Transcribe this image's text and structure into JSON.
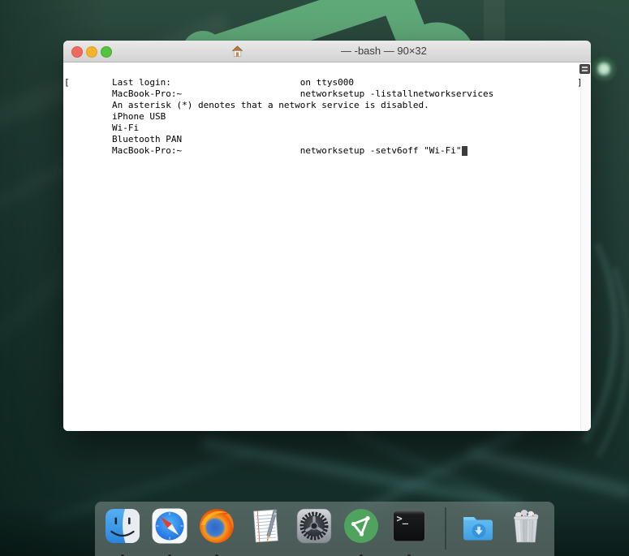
{
  "window": {
    "title": "— -bash — 90×32",
    "traffic_lights": {
      "close_color": "#ee6a5f",
      "minimize_color": "#f4b32e",
      "zoom_color": "#57c23e"
    },
    "proxy_icon": "home-folder-icon",
    "terminal": {
      "left_bracket": "[",
      "right_bracket": "]",
      "lines": [
        "Last login:                        on ttys000",
        "MacBook-Pro:~                      networksetup -listallnetworkservices",
        "An asterisk (*) denotes that a network service is disabled.",
        "iPhone USB",
        "Wi-Fi",
        "Bluetooth PAN",
        "MacBook-Pro:~                      networksetup -setv6off \"Wi-Fi\""
      ],
      "network_services": [
        "iPhone USB",
        "Wi-Fi",
        "Bluetooth PAN"
      ],
      "cursor": "block"
    }
  },
  "dock": {
    "apps": [
      {
        "name": "Finder",
        "running": true
      },
      {
        "name": "Safari",
        "running": true
      },
      {
        "name": "Firefox",
        "running": true
      },
      {
        "name": "TextEdit",
        "running": false
      },
      {
        "name": "System Preferences",
        "running": false
      },
      {
        "name": "VPN",
        "running": true
      },
      {
        "name": "Terminal",
        "running": true
      }
    ],
    "shortcuts": [
      {
        "name": "Downloads"
      },
      {
        "name": "Trash"
      }
    ]
  },
  "wallpaper": {
    "base_color": "#22423a",
    "accent_shape_color": "#5fa878",
    "glow_color": "#eafff2"
  }
}
